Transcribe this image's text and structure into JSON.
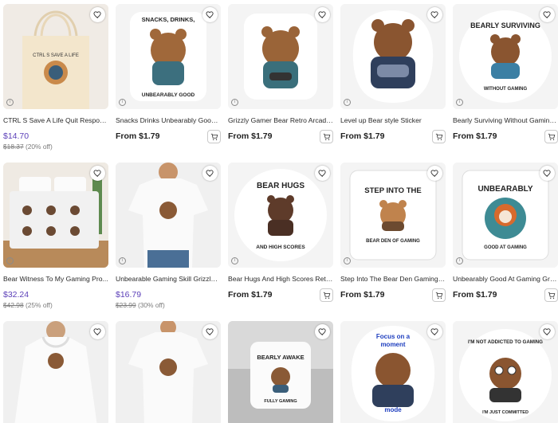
{
  "products": [
    {
      "title": "CTRL S Save A Life Quit Responsi...",
      "price": "$14.70",
      "old_price": "$18.37",
      "discount": "(20% off)",
      "image": "tote-bag"
    },
    {
      "title": "Snacks Drinks Unbearably Good ...",
      "price_from": "From $1.79",
      "image": "sticker-bear-snacks",
      "image_text_top": "SNACKS, DRINKS,",
      "image_text_bottom": "UNBEARABLY GOOD"
    },
    {
      "title": "Grizzly Gamer Bear Retro Arcade ...",
      "price_from": "From $1.79",
      "image": "sticker-bear-arcade"
    },
    {
      "title": "Level up Bear style Sticker",
      "price_from": "From $1.79",
      "image": "sticker-bear-levelup"
    },
    {
      "title": "Bearly Surviving Without Gaming ...",
      "price_from": "From $1.79",
      "image": "sticker-bearly-surviving",
      "image_text_top": "BEARLY SURVIVING",
      "image_text_bottom": "WITHOUT GAMING"
    },
    {
      "title": "Bear Witness To My Gaming Pro...",
      "price": "$32.24",
      "old_price": "$42.98",
      "discount": "(25% off)",
      "image": "comforter"
    },
    {
      "title": "Unbearable Gaming Skill Grizzly ...",
      "price": "$16.79",
      "old_price": "$23.99",
      "discount": "(30% off)",
      "image": "tshirt"
    },
    {
      "title": "Bear Hugs And High Scores Retr...",
      "price_from": "From $1.79",
      "image": "sticker-bear-hugs",
      "image_text_top": "BEAR HUGS",
      "image_text_bottom": "AND HIGH SCORES"
    },
    {
      "title": "Step Into The Bear Den Gaming R...",
      "price_from": "From $1.79",
      "image": "sticker-bear-den",
      "image_text_top": "STEP INTO THE",
      "image_text_bottom": "BEAR DEN OF GAMING"
    },
    {
      "title": "Unbearably Good At Gaming Griz...",
      "price_from": "From $1.79",
      "image": "sticker-unbearably-good",
      "image_text_top": "UNBEARABLY",
      "image_text_bottom": "GOOD AT GAMING"
    },
    {
      "image": "hoodie"
    },
    {
      "image": "tshirt-2"
    },
    {
      "image": "pillow",
      "image_text_top": "BEARLY AWAKE",
      "image_text_bottom": "FULLY GAMING"
    },
    {
      "image": "sticker-focus-mode",
      "image_text_top": "Focus on a",
      "image_text_mid": "moment",
      "image_text_bottom": "mode"
    },
    {
      "image": "sticker-not-addicted",
      "image_text_top": "I'M NOT ADDICTED TO GAMING",
      "image_text_bottom": "I'M JUST COMMITTED"
    }
  ],
  "icons": {
    "favorite": "heart-icon",
    "cart": "cart-add-icon",
    "info": "info-icon"
  },
  "colors": {
    "sale_price": "#5b3fb8",
    "old_price": "#7b7b7b"
  }
}
